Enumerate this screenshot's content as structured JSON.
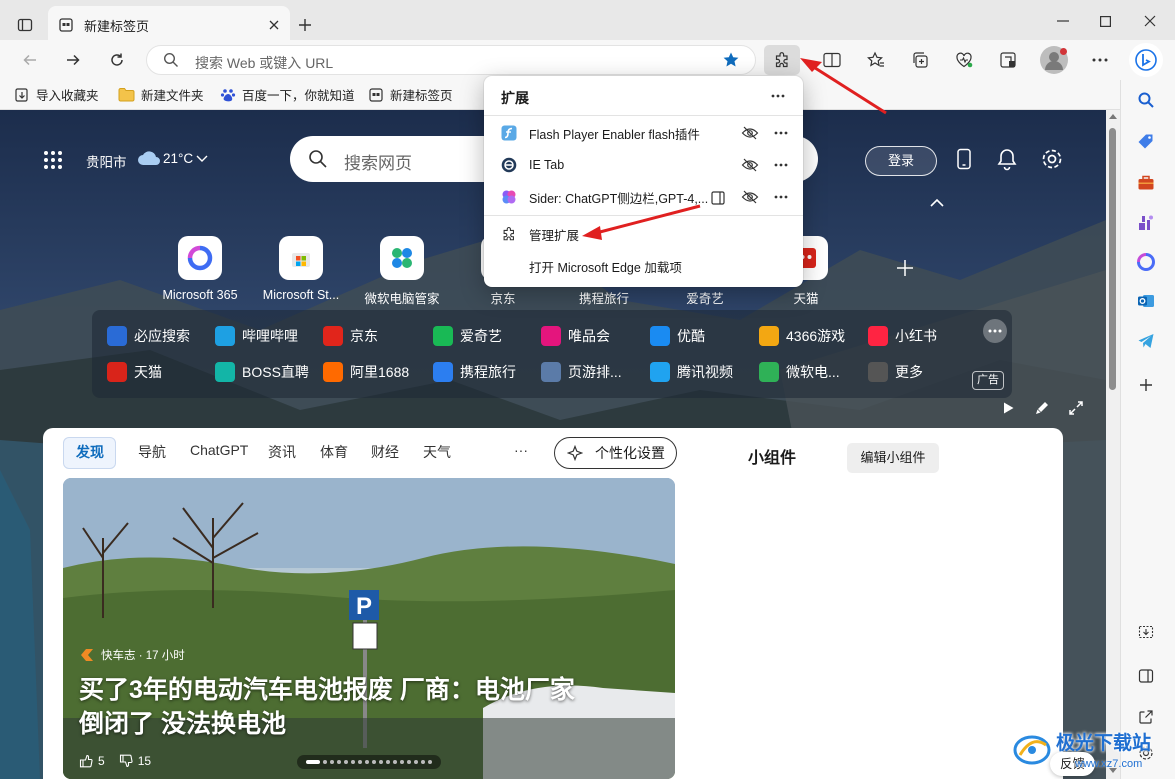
{
  "tab": {
    "title": "新建标签页"
  },
  "address_bar": {
    "placeholder": "搜索 Web 或键入 URL"
  },
  "favorites": [
    {
      "label": "导入收藏夹"
    },
    {
      "label": "新建文件夹"
    },
    {
      "label": "百度一下，你就知道"
    },
    {
      "label": "新建标签页"
    }
  ],
  "weather": {
    "city": "贵阳市",
    "temp": "21°C"
  },
  "page_search": {
    "placeholder": "搜索网页"
  },
  "login_label": "登录",
  "quick_links": [
    {
      "label": "Microsoft 365"
    },
    {
      "label": "Microsoft St..."
    },
    {
      "label": "微软电脑管家"
    },
    {
      "label": "京东"
    },
    {
      "label": "携程旅行"
    },
    {
      "label": "爱奇艺"
    },
    {
      "label": "天猫"
    }
  ],
  "link_rows": [
    [
      {
        "label": "必应搜索",
        "color": "#2a6bd6"
      },
      {
        "label": "哔哩哔哩",
        "color": "#1ea0e3"
      },
      {
        "label": "京东",
        "color": "#e1251b"
      },
      {
        "label": "爱奇艺",
        "color": "#19b955"
      },
      {
        "label": "唯品会",
        "color": "#e4157d"
      },
      {
        "label": "优酷",
        "color": "#1a8bf2"
      },
      {
        "label": "4366游戏",
        "color": "#f3a712"
      },
      {
        "label": "小红书",
        "color": "#ff2442"
      }
    ],
    [
      {
        "label": "天猫",
        "color": "#d9241a"
      },
      {
        "label": "BOSS直聘",
        "color": "#13b5a7"
      },
      {
        "label": "阿里1688",
        "color": "#ff6a00"
      },
      {
        "label": "携程旅行",
        "color": "#2c7ef0"
      },
      {
        "label": "页游排...",
        "color": "#5b7ba8"
      },
      {
        "label": "腾讯视频",
        "color": "#20a3f0"
      },
      {
        "label": "微软电...",
        "color": "#2fb157"
      },
      {
        "label": "更多",
        "color": "#555555"
      }
    ]
  ],
  "ad_label": "广告",
  "content_tabs": [
    "发现",
    "导航",
    "ChatGPT",
    "资讯",
    "体育",
    "财经",
    "天气"
  ],
  "more_tabs": "···",
  "personalize_label": "个性化设置",
  "widgets": {
    "title": "小组件",
    "edit_label": "编辑小组件"
  },
  "hero": {
    "source": "快车志 · 17 小时",
    "headline_1": "买了3年的电动汽车电池报废 厂商：电池厂家",
    "headline_2": "倒闭了 没法换电池",
    "likes": "5",
    "dislikes": "15"
  },
  "feedback_label": "反馈",
  "watermark": "极光下载站",
  "watermark_url": "www.xz7.com",
  "extensions_popup": {
    "title": "扩展",
    "items": [
      {
        "name": "Flash Player Enabler flash插件"
      },
      {
        "name": "IE Tab"
      },
      {
        "name": "Sider: ChatGPT侧边栏,GPT-4,..."
      }
    ],
    "manage_label": "管理扩展",
    "open_addons_label": "打开 Microsoft Edge 加载项"
  },
  "colors": {
    "accent": "#0f6cbd",
    "annotation_arrow": "#e02020"
  }
}
